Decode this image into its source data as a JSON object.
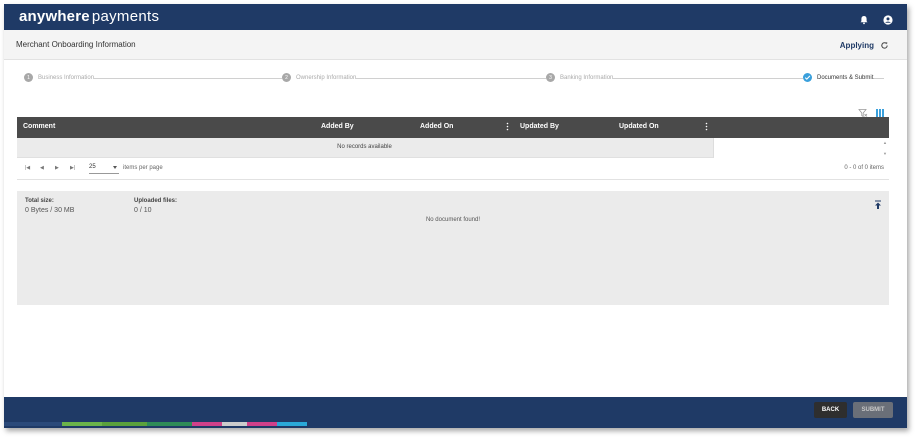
{
  "header": {
    "brand_bold": "anywhere",
    "brand_light": "payments",
    "colors": {
      "bar": "#1f3a66",
      "accent": "#3aa0dc"
    },
    "icons": [
      "bell-icon",
      "user-circle-icon"
    ]
  },
  "subheader": {
    "title": "Merchant Onboarding Information",
    "status": "Applying"
  },
  "stepper": {
    "steps": [
      {
        "number": "1",
        "label": "Business Information",
        "state": "pending"
      },
      {
        "number": "2",
        "label": "Ownership Information",
        "state": "pending"
      },
      {
        "number": "3",
        "label": "Banking Information",
        "state": "pending"
      },
      {
        "number": "",
        "label": "Documents & Submit",
        "state": "done"
      }
    ]
  },
  "grid": {
    "columns": [
      "Comment",
      "Added By",
      "Added On",
      "Updated By",
      "Updated On"
    ],
    "empty_text": "No records available",
    "pager": {
      "page_size": "25",
      "per_page_label": "items per page",
      "info": "0 - 0 of 0 items"
    }
  },
  "upload": {
    "total_size_label": "Total size:",
    "total_size_value": "0 Bytes / 30 MB",
    "uploaded_label": "Uploaded files:",
    "uploaded_value": "0 / 10",
    "empty_text": "No document found!"
  },
  "footer": {
    "back_label": "BACK",
    "submit_label": "SUBMIT"
  }
}
